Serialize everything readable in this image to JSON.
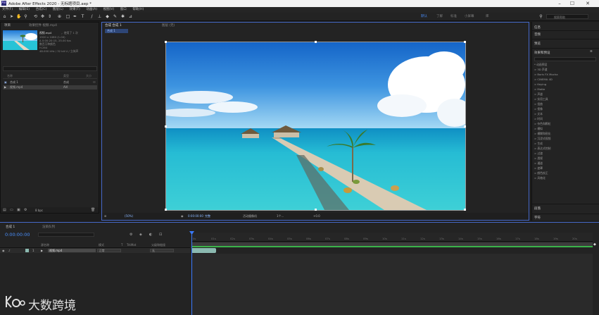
{
  "titlebar": {
    "title": "Adobe After Effects 2020 - 无标题项目.aep *",
    "app_icon": "Ae"
  },
  "menu": [
    "文件(F)",
    "编辑(E)",
    "合成(C)",
    "图层(L)",
    "效果(T)",
    "动画(A)",
    "视图(V)",
    "窗口",
    "帮助(H)"
  ],
  "workspaces": {
    "active": "默认",
    "items": [
      "了解",
      "标准",
      "小屏幕",
      "库"
    ]
  },
  "search_help": {
    "placeholder": "搜索帮助"
  },
  "project": {
    "tabs": [
      "项目",
      "效果控件 视频.mp4"
    ],
    "selected_item": "视频.mp4",
    "used_count": "，使用了 1 次",
    "meta": [
      "1920 x 1080 (1.00)",
      "Δ 0:00:20:15, 25.00 fps",
      "数百万种颜色",
      "H.264",
      "48.000 kHz / 32 bit U / 立体声"
    ],
    "columns": [
      "名称",
      "类型",
      "大小"
    ],
    "rows": [
      {
        "name": "合成 1",
        "type": "合成",
        "size": ""
      },
      {
        "name": "视频.mp4",
        "type": "AVI",
        "size": ""
      }
    ],
    "footer_bpc": "8 bpc"
  },
  "composition": {
    "tabs": [
      "合成 合成 1",
      "图层 (无)"
    ],
    "breadcrumb": "合成 1",
    "bottom_bar": {
      "zoom": "(50%)",
      "timecode": "0:00:00:00",
      "quality": "完整",
      "camera": "活动摄像机",
      "views": "1个...",
      "offset": "+0.0"
    }
  },
  "right_panel": {
    "sections": [
      "信息",
      "音频",
      "预览",
      "效果和预设"
    ],
    "effects": [
      "* 动画预设",
      "> 3D 声道",
      "> Boris FX Mocha",
      "> CINEMA 4D",
      "> Keying",
      "> Matte",
      "> 声道",
      "> 实用工具",
      "> 扭曲",
      "> 抠像",
      "> 文本",
      "> 时间",
      "> 杂色和颗粒",
      "> 模拟",
      "> 模糊和锐化",
      "> 沉浸式视频",
      "> 生成",
      "> 表达式控制",
      "> 过渡",
      "> 透视",
      "> 通道",
      "> 遮罩",
      "> 颜色校正",
      "> 风格化"
    ],
    "bottom_sections": [
      "段落",
      "字符"
    ]
  },
  "timeline": {
    "tabs": [
      "合成 1",
      "渲染队列"
    ],
    "timecode": "0:00:00:00",
    "columns": [
      "源名称",
      "模式",
      "T",
      "TrkMat",
      "父级和链接"
    ],
    "layer": {
      "index": "1",
      "name": "视频.mp4",
      "mode": "正常",
      "parent": "无"
    },
    "ruler_ticks": [
      "0s",
      "01s",
      "02s",
      "03s",
      "04s",
      "05s",
      "06s",
      "07s",
      "08s",
      "09s",
      "10s",
      "11s",
      "12s",
      "13s",
      "14s",
      "15s",
      "16s",
      "17s",
      "18s",
      "19s",
      "20s"
    ]
  },
  "watermark": {
    "text": "大数跨境"
  },
  "colors": {
    "accent": "#4a90ff",
    "panel_bg": "#232323",
    "title_bg": "#f2f2f2",
    "work_area_green": "#3bb34a",
    "clip": "#8bb9b0"
  }
}
